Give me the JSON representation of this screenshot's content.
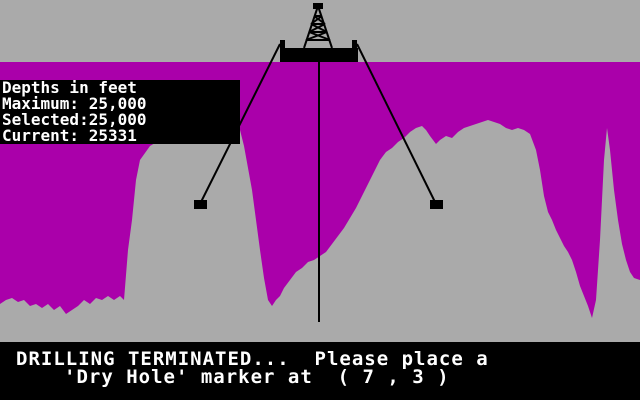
{
  "colors": {
    "sky": "#AAAAAA",
    "rock": "#AA00AA",
    "ground": "#AAAAAA",
    "ink": "#000000",
    "text": "#FFFFFF"
  },
  "icons": [
    "drilling-rig-icon",
    "well-marker-left",
    "well-marker-right"
  ],
  "depth_panel": {
    "heading": "Depths in feet",
    "maximum_label": "Maximum:",
    "maximum_value": "25,000",
    "selected_label": "Selected:",
    "selected_value": "25,000",
    "current_label": "Current:",
    "current_value": "25331"
  },
  "status": {
    "line1": "DRILLING TERMINATED...  Please place a",
    "line2_prefix": "'Dry Hole' marker at",
    "line2_coords": "( 7 , 3 )"
  }
}
